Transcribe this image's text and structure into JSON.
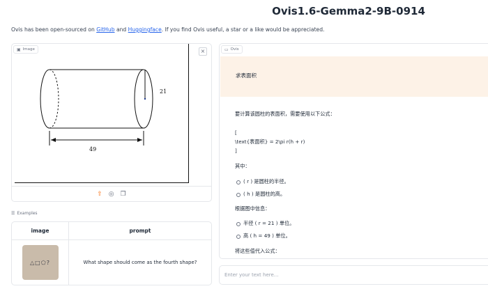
{
  "app": {
    "title": "Ovis1.6-Gemma2-9B-0914"
  },
  "intro": {
    "before": "Ovis has been open-sourced on ",
    "link1": "GitHub",
    "middle": " and ",
    "link2": "Huggingface",
    "after": ". If you find Ovis useful, a star or a like would be appreciated."
  },
  "image_panel": {
    "label": "Image",
    "diagram": {
      "height_label": "21",
      "length_label": "49"
    }
  },
  "examples": {
    "label": "Examples",
    "columns": [
      "image",
      "prompt"
    ],
    "rows": [
      {
        "prompt": "What shape should come as the fourth shape?",
        "thumb_symbols": "△□⬠?"
      }
    ]
  },
  "chat": {
    "label": "Ovis",
    "user_message": "求表面积",
    "bot_lines": [
      {
        "text": "要计算该圆柱的表面积，需要使用以下公式：",
        "bullet": false
      },
      {
        "text": "[",
        "bullet": false
      },
      {
        "text": "\\text{表面积} = 2\\pi r(h + r)",
        "bullet": false
      },
      {
        "text": "]",
        "bullet": false
      },
      {
        "text": "其中：",
        "bullet": false
      },
      {
        "text": "( r ) 是圆柱的半径。",
        "bullet": true
      },
      {
        "text": "( h ) 是圆柱的高。",
        "bullet": true
      },
      {
        "text": "根据图中信息：",
        "bullet": false
      },
      {
        "text": "半径 ( r = 21 ) 单位。",
        "bullet": true
      },
      {
        "text": "高 ( h = 49 ) 单位。",
        "bullet": true
      },
      {
        "text": "将这些值代入公式：",
        "bullet": false
      }
    ]
  },
  "input": {
    "placeholder": "Enter your text here..."
  }
}
